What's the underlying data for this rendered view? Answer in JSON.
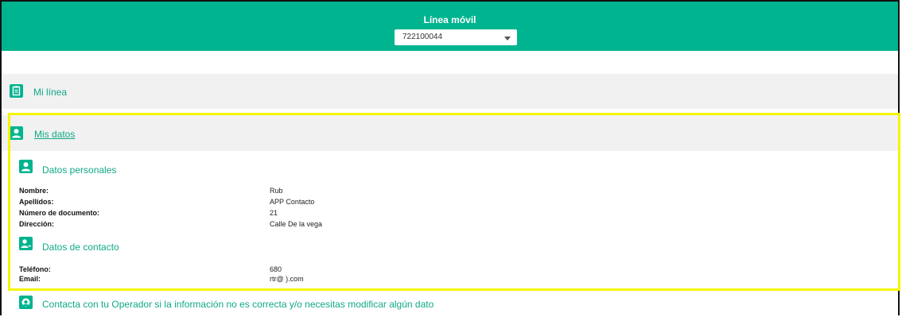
{
  "header": {
    "title": "Línea móvil",
    "line_select_value": "722100044"
  },
  "sections": {
    "mi_linea": {
      "label": "Mi línea"
    },
    "mis_datos": {
      "label": "Mis datos"
    }
  },
  "datos_personales": {
    "heading": "Datos personales",
    "fields": [
      {
        "label": "Nombre:",
        "value": "Rub"
      },
      {
        "label": "Apellidos:",
        "value": "APP Contacto"
      },
      {
        "label": "Número de documento:",
        "value": "21"
      },
      {
        "label": "Dirección:",
        "value": "Calle De la vega"
      }
    ]
  },
  "datos_contacto": {
    "heading": "Datos de contacto",
    "fields": [
      {
        "label": "Teléfono:",
        "value": "680"
      },
      {
        "label": "Email:",
        "value": "rtr@ ).com"
      }
    ]
  },
  "footer_note": "Contacta con tu Operador si la información no es correcta y/o necesitas modificar algún dato",
  "colors": {
    "brand": "#00b48f",
    "band": "#f1f1f1",
    "highlight": "#f5f500"
  },
  "icons": [
    "clipboard-icon",
    "user-icon",
    "user-icon",
    "contact-user-icon",
    "operator-icon",
    "chevron-down-icon"
  ]
}
